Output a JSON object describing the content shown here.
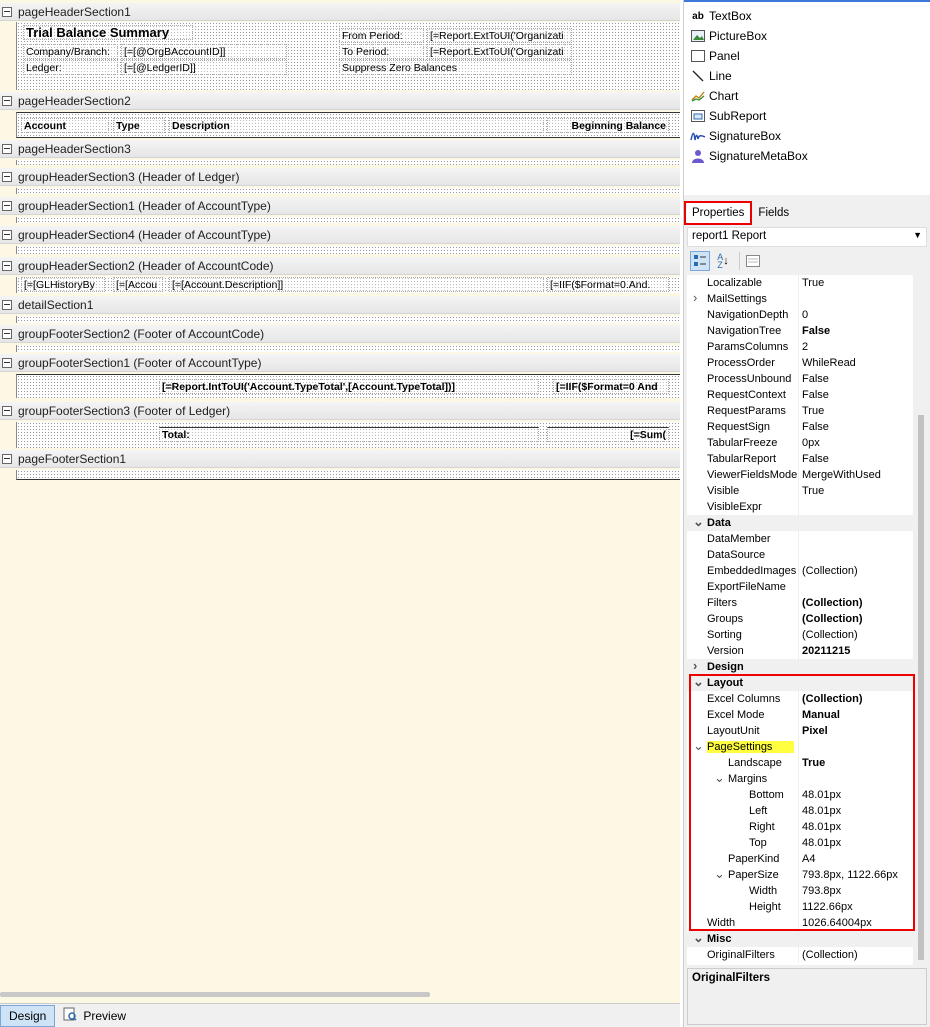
{
  "bands": [
    {
      "title": "pageHeaderSection1"
    },
    {
      "title": "pageHeaderSection2"
    },
    {
      "title": "pageHeaderSection3"
    },
    {
      "title": "groupHeaderSection3 (Header of Ledger)"
    },
    {
      "title": "groupHeaderSection1 (Header of AccountType)"
    },
    {
      "title": "groupHeaderSection4 (Header of AccountType)"
    },
    {
      "title": "groupHeaderSection2 (Header of AccountCode)"
    },
    {
      "title": "detailSection1"
    },
    {
      "title": "groupFooterSection2 (Footer of AccountCode)"
    },
    {
      "title": "groupFooterSection1 (Footer of AccountType)"
    },
    {
      "title": "groupFooterSection3 (Footer of Ledger)"
    },
    {
      "title": "pageFooterSection1"
    }
  ],
  "fields": {
    "ph1": [
      "Trial Balance Summary",
      "From Period:",
      "[=Report.ExtToUI('Organizati",
      "Company/Branch:",
      "[=[@OrgBAccountID]]",
      "To Period:",
      "[=Report.ExtToUI('Organizati",
      "Ledger:",
      "[=[@LedgerID]]",
      "Suppress Zero Balances"
    ],
    "ph2": [
      "Account",
      "Type",
      "Description",
      "Beginning Balance"
    ],
    "gh2": [
      "[=[GLHistoryBy",
      "[=[Accou",
      "[=[Account.Description]]",
      "[=IIF($Format=0.And."
    ],
    "gf1": [
      "[=Report.IntToUI('Account.TypeTotal',[Account.TypeTotal])]",
      "[=IIF($Format=0 And"
    ],
    "gf3": [
      "Total:",
      "[=Sum("
    ]
  },
  "bottom_tabs": [
    "Design",
    "Preview"
  ],
  "toolbox": [
    {
      "label": "TextBox",
      "icon": "textbox-icon"
    },
    {
      "label": "PictureBox",
      "icon": "picturebox-icon"
    },
    {
      "label": "Panel",
      "icon": "panel-icon"
    },
    {
      "label": "Line",
      "icon": "line-icon"
    },
    {
      "label": "Chart",
      "icon": "chart-icon"
    },
    {
      "label": "SubReport",
      "icon": "subreport-icon"
    },
    {
      "label": "SignatureBox",
      "icon": "signature-icon"
    },
    {
      "label": "SignatureMetaBox",
      "icon": "person-icon"
    }
  ],
  "panel_tabs": [
    "Properties",
    "Fields"
  ],
  "object_selector": "report1 Report",
  "properties": [
    {
      "name": "Localizable",
      "value": "True"
    },
    {
      "name": "MailSettings",
      "value": "",
      "expander": ">"
    },
    {
      "name": "NavigationDepth",
      "value": "0"
    },
    {
      "name": "NavigationTree",
      "value": "False",
      "bold": true
    },
    {
      "name": "ParamsColumns",
      "value": "2"
    },
    {
      "name": "ProcessOrder",
      "value": "WhileRead"
    },
    {
      "name": "ProcessUnbound",
      "value": "False"
    },
    {
      "name": "RequestContext",
      "value": "False"
    },
    {
      "name": "RequestParams",
      "value": "True"
    },
    {
      "name": "RequestSign",
      "value": "False"
    },
    {
      "name": "TabularFreeze",
      "value": "0px"
    },
    {
      "name": "TabularReport",
      "value": "False"
    },
    {
      "name": "ViewerFieldsMode",
      "value": "MergeWithUsed"
    },
    {
      "name": "Visible",
      "value": "True"
    },
    {
      "name": "VisibleExpr",
      "value": ""
    },
    {
      "name": "Data",
      "value": "",
      "category": true,
      "expander": "v"
    },
    {
      "name": "DataMember",
      "value": ""
    },
    {
      "name": "DataSource",
      "value": ""
    },
    {
      "name": "EmbeddedImages",
      "value": "(Collection)"
    },
    {
      "name": "ExportFileName",
      "value": ""
    },
    {
      "name": "Filters",
      "value": "(Collection)",
      "bold": true
    },
    {
      "name": "Groups",
      "value": "(Collection)",
      "bold": true
    },
    {
      "name": "Sorting",
      "value": "(Collection)"
    },
    {
      "name": "Version",
      "value": "20211215",
      "bold": true
    },
    {
      "name": "Design",
      "value": "",
      "category": true,
      "expander": ">"
    },
    {
      "name": "Layout",
      "value": "",
      "category": true,
      "expander": "v"
    },
    {
      "name": "Excel Columns",
      "value": "(Collection)",
      "bold": true
    },
    {
      "name": "Excel Mode",
      "value": "Manual",
      "bold": true
    },
    {
      "name": "LayoutUnit",
      "value": "Pixel",
      "bold": true
    },
    {
      "name": "PageSettings",
      "value": "",
      "expander": "v",
      "highlight": true
    },
    {
      "name": "Landscape",
      "value": "True",
      "bold": true,
      "level": 1
    },
    {
      "name": "Margins",
      "value": "",
      "expander": "v",
      "level": 1
    },
    {
      "name": "Bottom",
      "value": "48.01px",
      "level": 2
    },
    {
      "name": "Left",
      "value": "48.01px",
      "level": 2
    },
    {
      "name": "Right",
      "value": "48.01px",
      "level": 2
    },
    {
      "name": "Top",
      "value": "48.01px",
      "level": 2
    },
    {
      "name": "PaperKind",
      "value": "A4",
      "level": 1
    },
    {
      "name": "PaperSize",
      "value": "793.8px, 1122.66px",
      "expander": "v",
      "level": 1
    },
    {
      "name": "Width",
      "value": "793.8px",
      "level": 2
    },
    {
      "name": "Height",
      "value": "1122.66px",
      "level": 2
    },
    {
      "name": "Width",
      "value": "1026.64004px"
    },
    {
      "name": "Misc",
      "value": "",
      "category": true,
      "expander": "v"
    },
    {
      "name": "OriginalFilters",
      "value": "(Collection)"
    }
  ],
  "description_title": "OriginalFilters"
}
